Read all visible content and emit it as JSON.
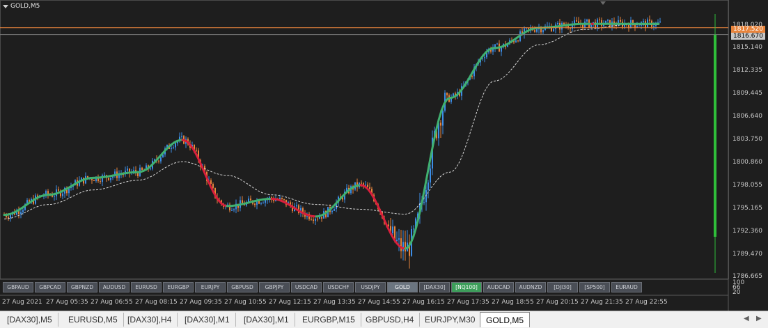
{
  "window": {
    "title": "GOLD,M5"
  },
  "price_axis": {
    "labels": [
      "1818.020",
      "1815.140",
      "1812.335",
      "1809.445",
      "1806.640",
      "1803.750",
      "1800.860",
      "1798.055",
      "1795.165",
      "1792.360",
      "1789.470",
      "1786.665"
    ],
    "ask_tag": "1817.520",
    "bid_tag": "1816.670"
  },
  "indicator_axis": {
    "labels": [
      "100",
      "66",
      "20"
    ]
  },
  "time_axis": {
    "labels": [
      "27 Aug 2021",
      "27 Aug 05:35",
      "27 Aug 06:55",
      "27 Aug 08:15",
      "27 Aug 09:35",
      "27 Aug 10:55",
      "27 Aug 12:15",
      "27 Aug 13:35",
      "27 Aug 14:55",
      "27 Aug 16:15",
      "27 Aug 17:35",
      "27 Aug 18:55",
      "27 Aug 20:15",
      "27 Aug 21:35",
      "27 Aug 22:55"
    ]
  },
  "symbol_buttons": [
    "GBPAUD",
    "GBPCAD",
    "GBPNZD",
    "AUDUSD",
    "EURUSD",
    "EURGBP",
    "EURJPY",
    "GBPUSD",
    "GBPJPY",
    "USDCAD",
    "USDCHF",
    "USDJPY",
    "GOLD",
    "[DAX30]",
    "[NQ100]",
    "AUDCAD",
    "AUDNZD",
    "[DJI30]",
    "[SP500]",
    "EURAUD"
  ],
  "active_symbol": "GOLD",
  "highlighted_symbol": "[NQ100]",
  "tabs": [
    "[DAX30],M5",
    "EURUSD,M5",
    "[DAX30],H4",
    "[DAX30],M1",
    "[DAX30],M1",
    "EURGBP,M15",
    "GBPUSD,H4",
    "EURJPY,M30",
    "GOLD,M5"
  ],
  "active_tab": "GOLD,M5",
  "colors": {
    "background": "#1e1e1e",
    "bull_candle": "#3c8de6",
    "bear_candle": "#e8843c",
    "ma_up": "#40b070",
    "ma_down": "#d81f3c",
    "slow_ma": "#d8d8d8",
    "ask_line": "#e8843c",
    "ask_tag_bg": "#e8843c",
    "bid_tag_bg": "#c8c8c8",
    "indicator_bar": "#2fbf3a"
  },
  "chart_data": {
    "type": "line",
    "title": "GOLD,M5",
    "x": [
      "27 Aug 2021",
      "27 Aug 05:35",
      "27 Aug 06:55",
      "27 Aug 08:15",
      "27 Aug 09:35",
      "27 Aug 10:55",
      "27 Aug 12:15",
      "27 Aug 13:35",
      "27 Aug 14:55",
      "27 Aug 16:15",
      "27 Aug 17:35",
      "27 Aug 18:55",
      "27 Aug 20:15",
      "27 Aug 21:35",
      "27 Aug 22:55"
    ],
    "series": [
      {
        "values": [
          1794.3,
          1796.8,
          1798.9,
          1799.6,
          1803.6,
          1795.4,
          1796.3,
          1794.1,
          1798.0,
          1790.1,
          1808.8,
          1815.0,
          1817.5,
          1818.0,
          1818.0
        ]
      },
      {
        "values": [
          1793.8,
          1795.6,
          1797.4,
          1798.6,
          1800.9,
          1799.2,
          1796.8,
          1795.6,
          1795.0,
          1794.4,
          1799.6,
          1810.9,
          1815.4,
          1817.3,
          1817.9
        ]
      }
    ],
    "ylim": [
      1786.665,
      1819.4
    ],
    "grid": false
  }
}
